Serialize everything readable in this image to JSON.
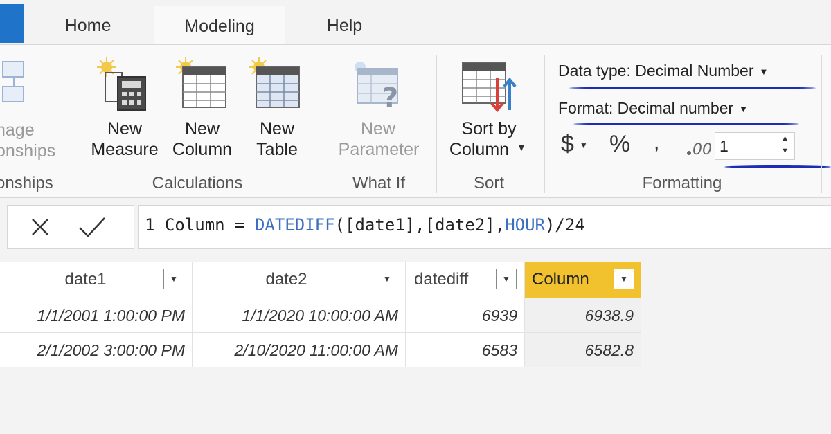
{
  "tabs": [
    {
      "label": "Home"
    },
    {
      "label": "Modeling"
    },
    {
      "label": "Help"
    }
  ],
  "ribbon": {
    "relationships": {
      "button_line1": "nage",
      "button_line2": "onships",
      "group_label": "onships"
    },
    "calculations": {
      "group_label": "Calculations",
      "buttons": [
        {
          "line1": "New",
          "line2": "Measure"
        },
        {
          "line1": "New",
          "line2": "Column"
        },
        {
          "line1": "New",
          "line2": "Table"
        }
      ]
    },
    "what_if": {
      "group_label": "What If",
      "button_line1": "New",
      "button_line2": "Parameter"
    },
    "sort": {
      "group_label": "Sort",
      "button_line1": "Sort by",
      "button_line2": "Column"
    },
    "formatting": {
      "group_label": "Formatting",
      "data_type": "Data type: Decimal Number",
      "format": "Format: Decimal number",
      "currency_symbol": "$",
      "percent_symbol": "%",
      "comma_symbol": ",",
      "decimal_places": "1"
    }
  },
  "formula_bar": {
    "line_number": "1",
    "prefix": " Column = ",
    "func": "DATEDIFF",
    "args": "([date1],[date2],",
    "keyword": "HOUR",
    "suffix": ")/24"
  },
  "table": {
    "columns": [
      "date1",
      "date2",
      "datediff",
      "Column"
    ],
    "rows": [
      [
        "1/1/2001 1:00:00 PM",
        "1/1/2020 10:00:00 AM",
        "6939",
        "6938.9"
      ],
      [
        "2/1/2002 3:00:00 PM",
        "2/10/2020 11:00:00 AM",
        "6583",
        "6582.8"
      ]
    ]
  },
  "colors": {
    "accent_blue": "#1f73c8",
    "selected_column": "#f2c12e",
    "pen_annotation": "#1c2cb4"
  }
}
